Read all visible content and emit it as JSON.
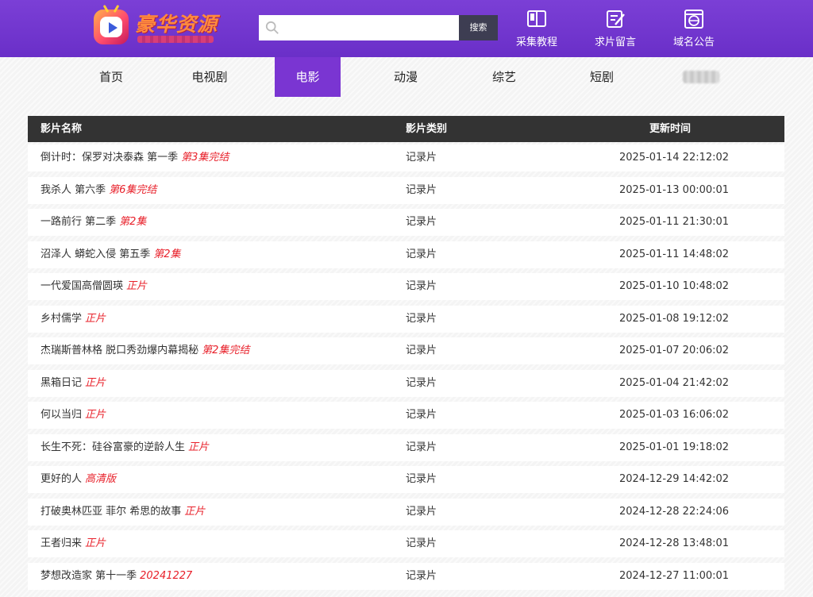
{
  "header": {
    "logo_text": "豪华资源",
    "search": {
      "placeholder": "",
      "button_label": "搜索"
    },
    "links": [
      {
        "label": "采集教程",
        "icon": "book-icon"
      },
      {
        "label": "求片留言",
        "icon": "edit-icon"
      },
      {
        "label": "域名公告",
        "icon": "globe-window-icon"
      }
    ]
  },
  "nav": {
    "items": [
      {
        "label": "首页"
      },
      {
        "label": "电视剧"
      },
      {
        "label": "电影",
        "active": true
      },
      {
        "label": "动漫"
      },
      {
        "label": "综艺"
      },
      {
        "label": "短剧"
      }
    ]
  },
  "table": {
    "headers": [
      "影片名称",
      "影片类别",
      "更新时间"
    ],
    "rows": [
      {
        "name": "倒计时：保罗对决泰森 第一季",
        "tag": "第3集完结",
        "category": "记录片",
        "time": "2025-01-14 22:12:02"
      },
      {
        "name": "我杀人 第六季",
        "tag": "第6集完结",
        "category": "记录片",
        "time": "2025-01-13 00:00:01"
      },
      {
        "name": "一路前行 第二季",
        "tag": "第2集",
        "category": "记录片",
        "time": "2025-01-11 21:30:01"
      },
      {
        "name": "沼泽人 蟒蛇入侵 第五季",
        "tag": "第2集",
        "category": "记录片",
        "time": "2025-01-11 14:48:02"
      },
      {
        "name": "一代爱国高僧圆瑛",
        "tag": "正片",
        "category": "记录片",
        "time": "2025-01-10 10:48:02"
      },
      {
        "name": "乡村儒学",
        "tag": "正片",
        "category": "记录片",
        "time": "2025-01-08 19:12:02"
      },
      {
        "name": "杰瑞斯普林格 脱口秀劲爆内幕揭秘",
        "tag": "第2集完结",
        "category": "记录片",
        "time": "2025-01-07 20:06:02"
      },
      {
        "name": "黑箱日记",
        "tag": "正片",
        "category": "记录片",
        "time": "2025-01-04 21:42:02"
      },
      {
        "name": "何以当归",
        "tag": "正片",
        "category": "记录片",
        "time": "2025-01-03 16:06:02"
      },
      {
        "name": "长生不死：硅谷富豪的逆龄人生",
        "tag": "正片",
        "category": "记录片",
        "time": "2025-01-01 19:18:02"
      },
      {
        "name": "更好的人",
        "tag": "高清版",
        "category": "记录片",
        "time": "2024-12-29 14:42:02"
      },
      {
        "name": "打破奥林匹亚 菲尔 希思的故事",
        "tag": "正片",
        "category": "记录片",
        "time": "2024-12-28 22:24:06"
      },
      {
        "name": "王者归来",
        "tag": "正片",
        "category": "记录片",
        "time": "2024-12-28 13:48:01"
      },
      {
        "name": "梦想改造家 第十一季",
        "tag": "20241227",
        "category": "记录片",
        "time": "2024-12-27 11:00:01"
      }
    ]
  },
  "colors": {
    "header": "#6a2fc8",
    "active_nav": "#7a35d2",
    "tag": "#e8202a",
    "table_head": "#333333"
  }
}
